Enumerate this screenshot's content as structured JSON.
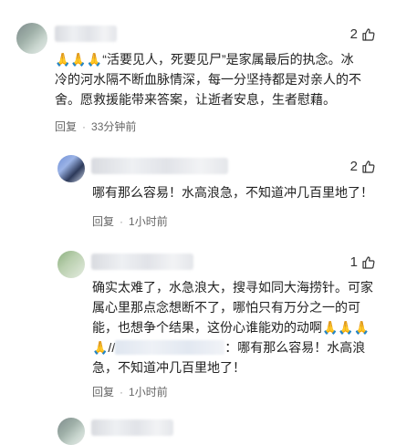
{
  "comments": [
    {
      "likes": "2",
      "text_lines": [
        "🙏🙏🙏“活要见人，死要见尸”是家属最后的执念。冰",
        "冷的河水隔不断血脉情深，每一分坚持都是对亲人的不",
        "舍。愿救援能带来答案，让逝者安息，生者慰藉。"
      ],
      "reply_label": "回复",
      "time": "33分钟前"
    },
    {
      "likes": "2",
      "text_lines": [
        "哪有那么容易！水高浪急，不知道冲几百里地了！"
      ],
      "reply_label": "回复",
      "time": "1小时前"
    },
    {
      "likes": "1",
      "text_lines": [
        "确实太难了，水急浪大，搜寻如同大海捞针。可家",
        "属心里那点念想断不了，哪怕只有万分之一的可",
        "能，也想争个结果，这份心谁能劝的动啊🙏🙏🙏",
        "🙏//",
        "：哪有那么容易！水高浪",
        "急，不知道冲几百里地了！"
      ],
      "reply_label": "回复",
      "time": "1小时前"
    }
  ],
  "colors": {
    "text": "#222222",
    "meta": "#666666",
    "emoji": "#e8a27a"
  },
  "icons": {
    "like": "thumbs-up-icon",
    "emoji": "pray-hands-emoji"
  }
}
